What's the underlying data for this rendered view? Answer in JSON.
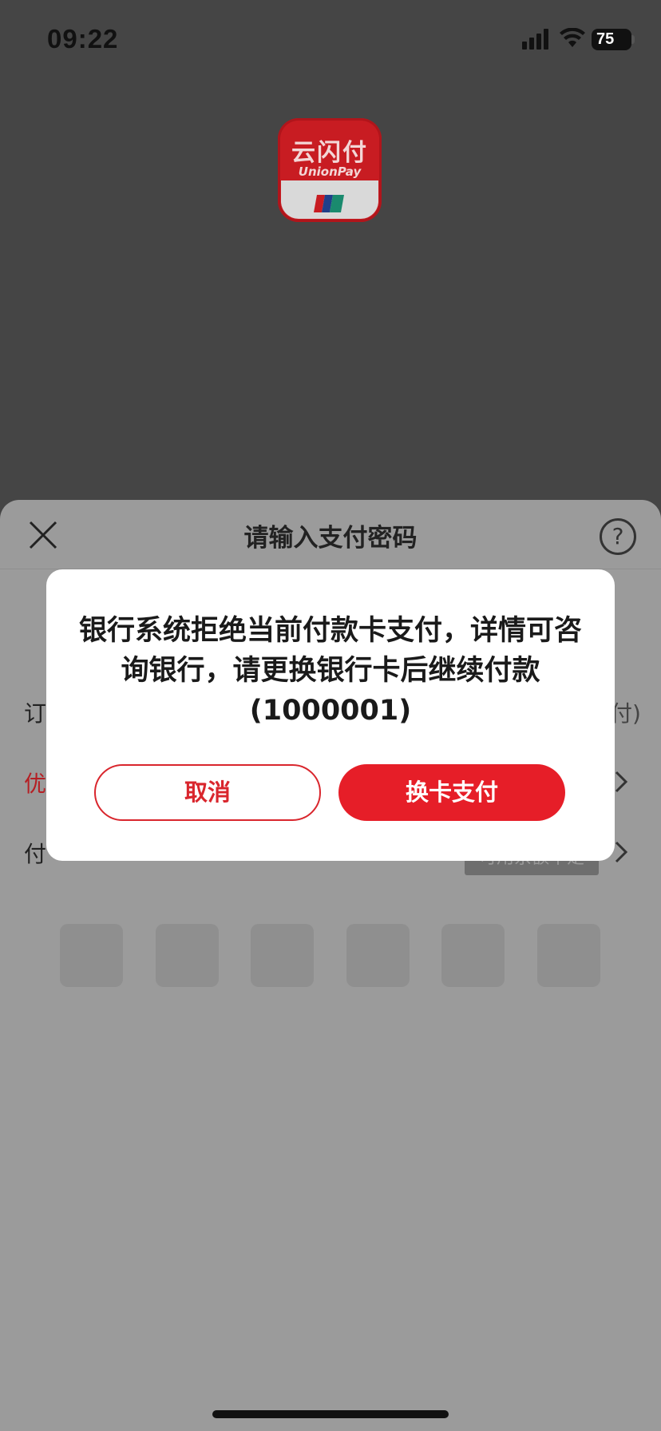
{
  "status_bar": {
    "time": "09:22",
    "battery": "75",
    "icons": [
      "signal-icon",
      "wifi-icon",
      "battery-icon"
    ]
  },
  "app_logo": {
    "name_cn": "云闪付",
    "name_en": "UnionPay"
  },
  "sheet": {
    "title": "请输入支付密码",
    "rows": [
      {
        "label": "订",
        "right": "付)"
      },
      {
        "label": "优",
        "right": ""
      },
      {
        "label": "付",
        "badge": "可用余额不足"
      }
    ],
    "pin_slots": 6
  },
  "dialog": {
    "message": "银行系统拒绝当前付款卡支付，详情可咨询银行，请更换银行卡后继续付款(1000001)",
    "cancel_label": "取消",
    "confirm_label": "换卡支付"
  },
  "colors": {
    "accent_red": "#e61e28",
    "overlay": "#454545",
    "sheet_dimmed": "#9b9b9b"
  }
}
